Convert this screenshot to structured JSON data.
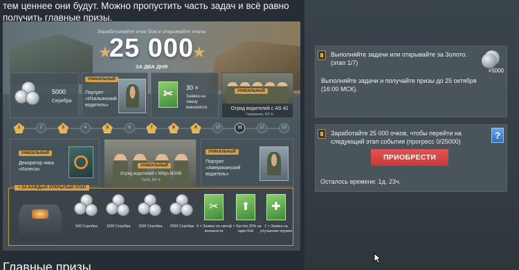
{
  "article": {
    "intro": "тем ценнее они будут. Можно пропустить часть задач и всё равно получить главные призы.",
    "heading": "Главные призы"
  },
  "banner": {
    "subtitle": "Зарабатывайте очки боя и открывайте этапы",
    "points": "25 000",
    "period": "ЗА ДВА ДНЯ",
    "top_cards": [
      {
        "value": "5000",
        "label": "Серебра"
      },
      {
        "badge": "УНИКАЛЬНЫЙ",
        "label": "Портрет «Итальянский водитель»"
      },
      {
        "value": "30 ×",
        "label": "Заявка на смену внешности"
      },
      {
        "badge": "УНИКАЛЬНЫЙ",
        "label": "Отряд водителей с AS 42",
        "sub": "Германия, БР II"
      }
    ],
    "stages": [
      "1",
      "2",
      "3",
      "4",
      "5",
      "6",
      "7",
      "8",
      "9",
      "10",
      "11",
      "12",
      "13"
    ],
    "gold_stages": [
      "1",
      "3",
      "5",
      "7",
      "8",
      "9"
    ],
    "selected_stage": "11",
    "middle_cards": [
      {
        "badge": "УНИКАЛЬНЫЙ",
        "label": "Декоратор ника «Колеса»"
      },
      {
        "badge": "УНИКАЛЬНЫЙ",
        "label": "Отряд водителей с Willys M2HB",
        "sub": "США, БР II"
      },
      {
        "badge": "УНИКАЛЬНЫЙ",
        "label": "Портрет «Американский водитель»"
      }
    ],
    "each_stage_label": "+ ЗА КАЖДЫЙ ОТКРЫТЫЙ ЭТАП",
    "rewards": [
      {
        "type": "coins",
        "caption": "500 Серебра"
      },
      {
        "type": "coins",
        "caption": "1000 Серебра"
      },
      {
        "type": "coins",
        "caption": "1500 Серебра"
      },
      {
        "type": "coins",
        "caption": "2000 Серебра"
      },
      {
        "type": "green",
        "caption": "6 × Заявка на смену внешности"
      },
      {
        "type": "green",
        "caption": "1 × Бустер 30% на один бой"
      },
      {
        "type": "green",
        "caption": "1 × Заявка на улучшение оружия"
      }
    ]
  },
  "tasks": [
    {
      "title": "Выполняйте задачи или открывайте за Золото. (этап 1/7)",
      "body": "Выполняйте задачи и получайте призы до 25 октября (16:00 МСК).",
      "reward_qty": "×5000"
    },
    {
      "title": "Заработайте 25 000 очков, чтобы перейти на следующий этап события (прогресс 0/25000)",
      "help_glyph": "?",
      "button": "ПРИОБРЕСТИ",
      "timer": "Осталось времени: 1д. 23ч."
    }
  ],
  "colors": {
    "accent_gold": "#d5a04c",
    "buy_button": "#d94848",
    "panel_bg": "#353e45"
  }
}
